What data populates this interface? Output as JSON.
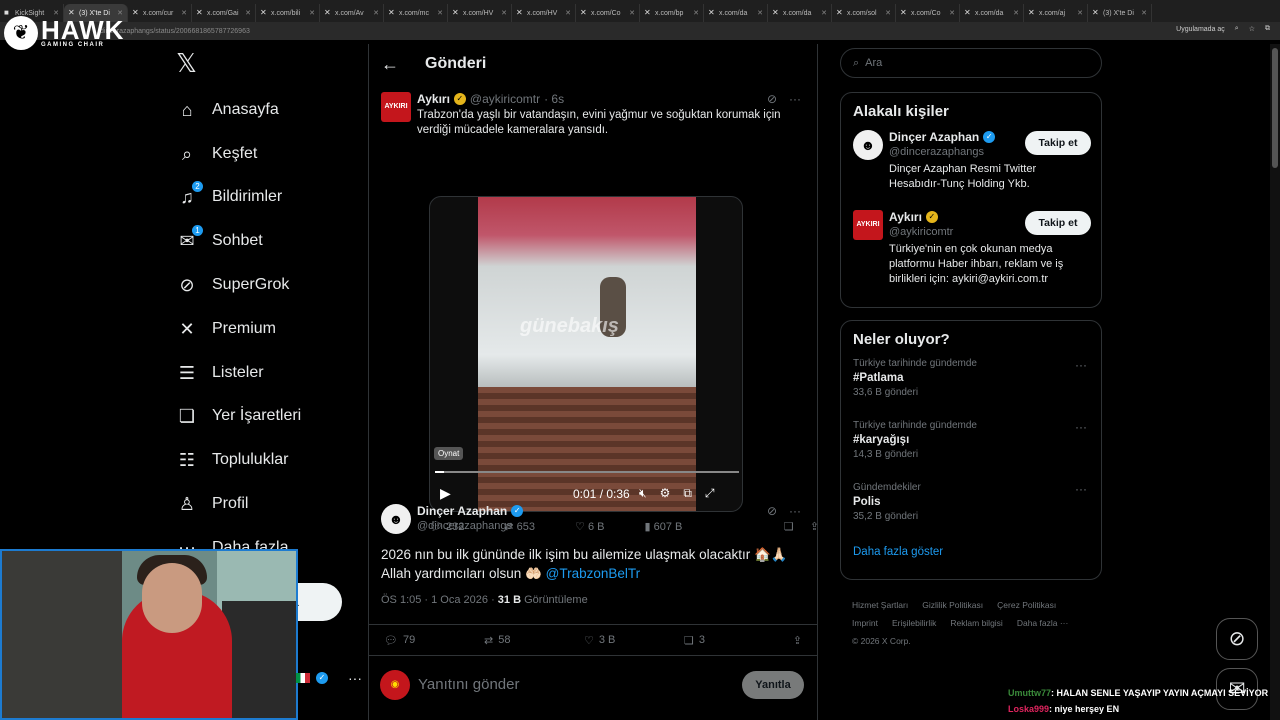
{
  "browser": {
    "tabs": [
      {
        "label": "KickSight",
        "icon": "kick-icon",
        "active": false
      },
      {
        "label": "(3) X'te Di",
        "icon": "x-icon",
        "active": true
      },
      {
        "label": "x.com/cur",
        "icon": "x-icon",
        "active": false
      },
      {
        "label": "x.com/Gai",
        "icon": "x-icon",
        "active": false
      },
      {
        "label": "x.com/bili",
        "icon": "x-icon",
        "active": false
      },
      {
        "label": "x.com/Av",
        "icon": "x-icon",
        "active": false
      },
      {
        "label": "x.com/mc",
        "icon": "x-icon",
        "active": false
      },
      {
        "label": "x.com/HV",
        "icon": "x-icon",
        "active": false
      },
      {
        "label": "x.com/HV",
        "icon": "x-icon",
        "active": false
      },
      {
        "label": "x.com/Co",
        "icon": "x-icon",
        "active": false
      },
      {
        "label": "x.com/bp",
        "icon": "x-icon",
        "active": false
      },
      {
        "label": "x.com/da",
        "icon": "x-icon",
        "active": false
      },
      {
        "label": "x.com/da",
        "icon": "x-icon",
        "active": false
      },
      {
        "label": "x.com/sol",
        "icon": "x-icon",
        "active": false
      },
      {
        "label": "x.com/Co",
        "icon": "x-icon",
        "active": false
      },
      {
        "label": "x.com/da",
        "icon": "x-icon",
        "active": false
      },
      {
        "label": "x.com/aj",
        "icon": "x-icon",
        "active": false
      },
      {
        "label": "(3) X'te Di",
        "icon": "x-icon",
        "active": false
      }
    ],
    "url": "dincerazaphangs/status/2006681865787726963",
    "open_app_label": "Uygulamada aç"
  },
  "overlay": {
    "brand": "HAWK",
    "brand_sub": "GAMING CHAIR"
  },
  "nav": {
    "items": [
      {
        "label": "Anasayfa",
        "icon": "home-icon",
        "glyph": "⌂",
        "badge": ""
      },
      {
        "label": "Keşfet",
        "icon": "search-icon",
        "glyph": "⌕",
        "badge": ""
      },
      {
        "label": "Bildirimler",
        "icon": "bell-icon",
        "glyph": "♫",
        "badge": "2"
      },
      {
        "label": "Sohbet",
        "icon": "mail-icon",
        "glyph": "✉",
        "badge": "1"
      },
      {
        "label": "SuperGrok",
        "icon": "grok-icon",
        "glyph": "⊘",
        "badge": ""
      },
      {
        "label": "Premium",
        "icon": "x-premium-icon",
        "glyph": "✕",
        "badge": ""
      },
      {
        "label": "Listeler",
        "icon": "list-icon",
        "glyph": "☰",
        "badge": ""
      },
      {
        "label": "Yer İşaretleri",
        "icon": "bookmark-icon",
        "glyph": "❏",
        "badge": ""
      },
      {
        "label": "Topluluklar",
        "icon": "communities-icon",
        "glyph": "☷",
        "badge": ""
      },
      {
        "label": "Profil",
        "icon": "profile-icon",
        "glyph": "♙",
        "badge": ""
      },
      {
        "label": "Daha fazla",
        "icon": "more-circle-icon",
        "glyph": "⋯",
        "badge": ""
      }
    ],
    "post_button": "a"
  },
  "header": {
    "title": "Gönderi"
  },
  "quoted_tweet": {
    "avatar_text": "AYKIRI",
    "name": "Aykırı",
    "handle": "@aykiricomtr",
    "time": "· 6s",
    "text": "Trabzon'da yaşlı bir vatandaşın, evini yağmur ve soğuktan korumak için verdiği mücadele kameralara yansıdı.",
    "video": {
      "watermark": "günebakış",
      "tooltip": "Oynat",
      "time": "0:01 / 0:36",
      "progress": 0.03
    },
    "stats": {
      "replies": "232",
      "retweets": "653",
      "likes": "6 B",
      "views": "607 B"
    }
  },
  "main_tweet": {
    "name": "Dinçer Azaphan",
    "handle": "@dincerazaphangs",
    "text": "2026 nın bu ilk gününde ilk işim bu ailemize ulaşmak olacaktır 🏠🙏🏻",
    "text2": "Allah yardımcıları olsun 🤲🏻 ",
    "mention": "@TrabzonBelTr",
    "time": "ÖS 1:05 · 1 Oca 2026 · ",
    "views": "31 B",
    "views_label": " Görüntüleme",
    "actions": {
      "replies": "79",
      "retweets": "58",
      "likes": "3 B",
      "bookmarks": "3"
    }
  },
  "reply": {
    "placeholder": "Yanıtını gönder",
    "button": "Yanıtla"
  },
  "search": {
    "placeholder": "Ara"
  },
  "related": {
    "title": "Alakalı kişiler",
    "people": [
      {
        "name": "Dinçer Azaphan",
        "handle": "@dincerazaphangs",
        "bio": "Dinçer Azaphan Resmi Twitter Hesabıdır-Tunç Holding Ykb.",
        "follow": "Takip et"
      },
      {
        "name": "Aykırı",
        "handle": "@aykiricomtr",
        "bio": "Türkiye'nin en çok okunan medya platformu Haber ihbarı, reklam ve iş birlikleri için: aykiri@aykiri.com.tr",
        "follow": "Takip et",
        "avatar_text": "AYKIRI"
      }
    ]
  },
  "trends": {
    "title": "Neler oluyor?",
    "items": [
      {
        "context": "Türkiye tarihinde gündemde",
        "name": "#Patlama",
        "count": "33,6 B gönderi"
      },
      {
        "context": "Türkiye tarihinde gündemde",
        "name": "#karyağışı",
        "count": "14,3 B gönderi"
      },
      {
        "context": "Gündemdekiler",
        "name": "Polis",
        "count": "35,2 B gönderi"
      }
    ],
    "show_more": "Daha fazla göster"
  },
  "footer": {
    "links": [
      "Hizmet Şartları",
      "Gizlilik Politikası",
      "Çerez Politikası",
      "Imprint",
      "Erişilebilirlik",
      "Reklam bilgisi",
      "Daha fazla ···"
    ],
    "copyright": "© 2026 X Corp."
  },
  "chat": [
    {
      "user": "Umuttw77",
      "msg": ": HALAN SENLE YAŞAYIP YAYIN AÇMAYI SEVİYOR",
      "color": "#3a8a3a"
    },
    {
      "user": "Loska999",
      "msg": ": niye herşey EN",
      "color": "#e0245e"
    }
  ]
}
